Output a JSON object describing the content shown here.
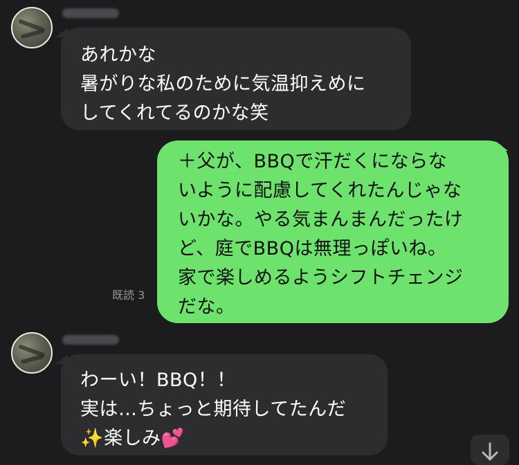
{
  "messages": [
    {
      "direction": "incoming",
      "lines": [
        "あれかな",
        "暑がりな私のために気温抑えめに",
        "してくれてるのかな笑"
      ]
    },
    {
      "direction": "outgoing",
      "read_status": "既読 3",
      "lines": [
        "＋父が、BBQで汗だくにならな",
        "いように配慮してくれたんじゃな",
        "いかな。やる気まんまんだったけ",
        "ど、庭でBBQは無理っぽいね。",
        "家で楽しめるようシフトチェンジ",
        "だな。"
      ]
    },
    {
      "direction": "incoming",
      "lines": [
        "わーい！BBQ！！",
        "実は…ちょっと期待してたんだ"
      ],
      "last_line": {
        "sparkle_icon": "✨",
        "text": "楽しみ",
        "heart_icon": "💕"
      }
    }
  ],
  "icons": [
    "avatar",
    "sparkles-icon",
    "two-hearts-icon",
    "arrow-down-icon"
  ],
  "colors": {
    "background": "#1c1c1e",
    "incoming_bubble": "#2d2d2f",
    "outgoing_bubble": "#6de26d"
  }
}
